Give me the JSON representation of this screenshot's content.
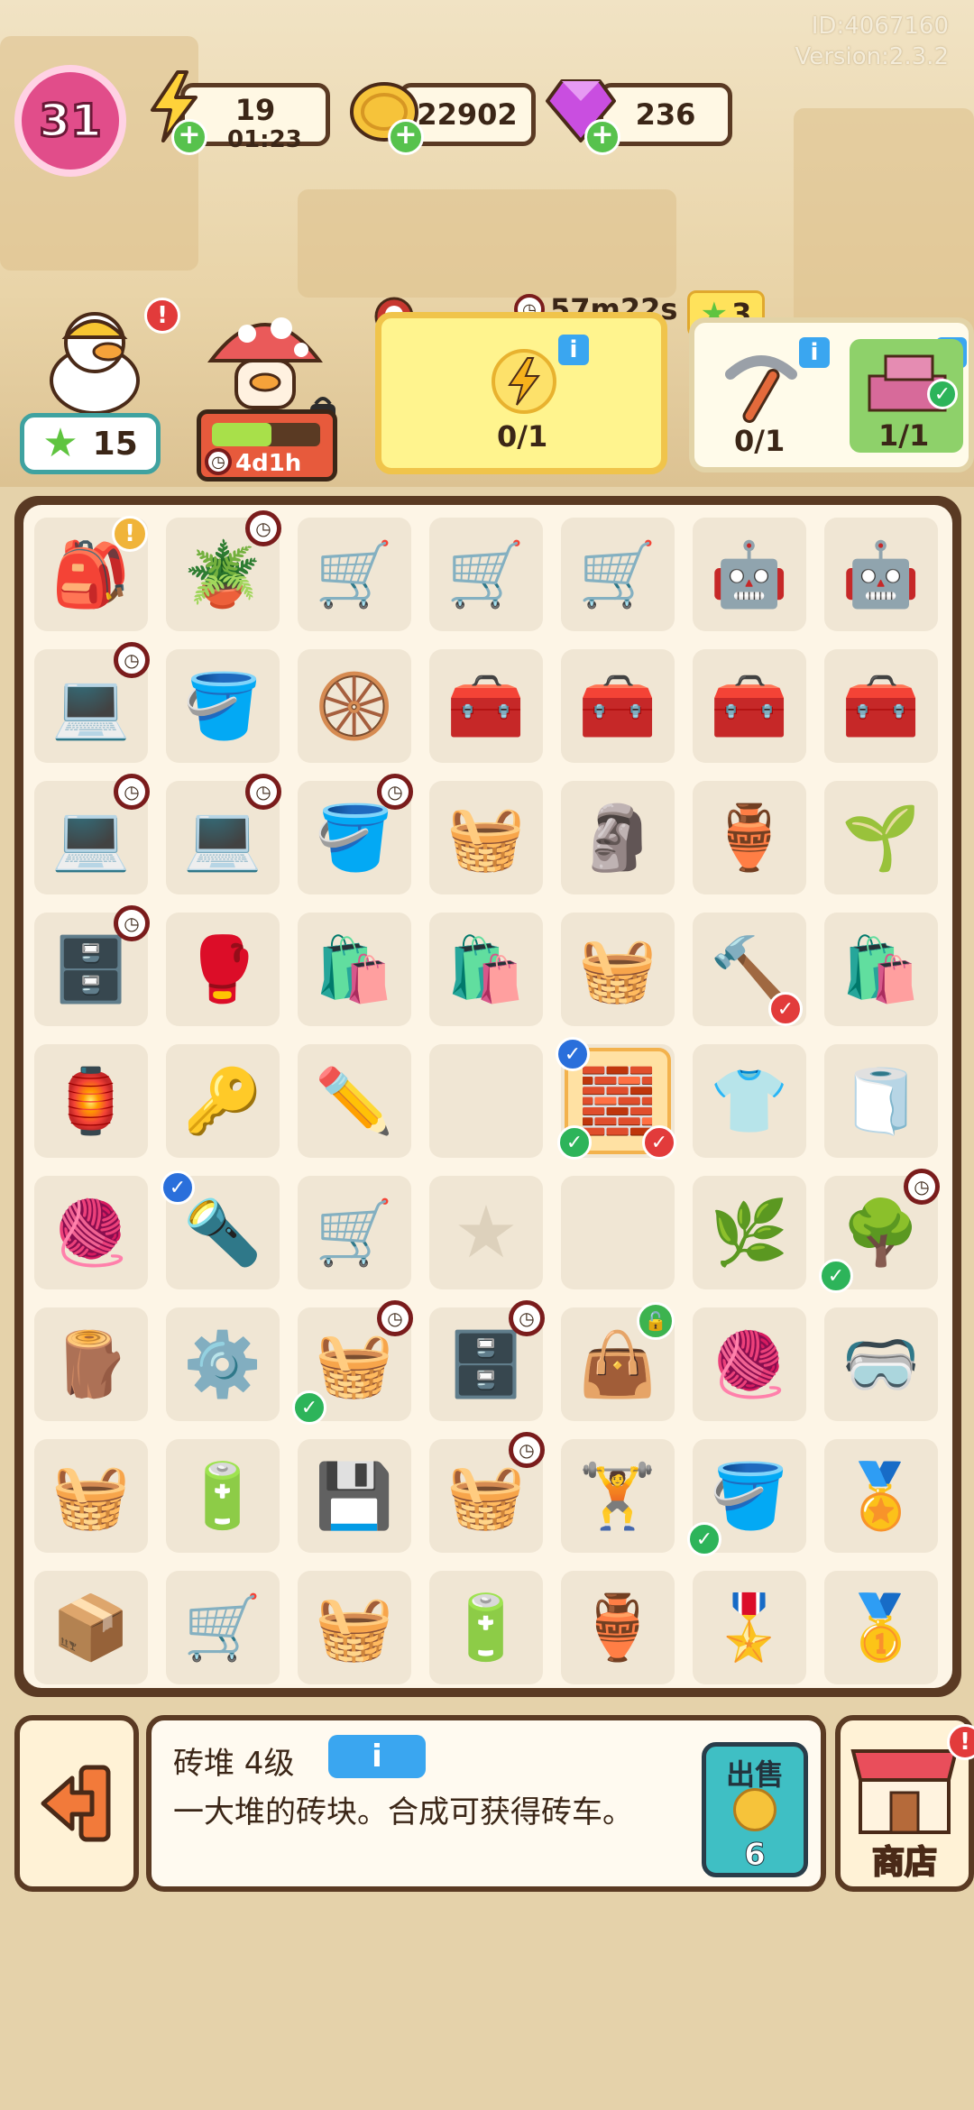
{
  "meta": {
    "id_text": "ID:4067160",
    "version_text": "Version:2.3.2"
  },
  "hud": {
    "level": "31",
    "energy": {
      "value": "19",
      "timer": "01:23",
      "icon": "lightning-icon"
    },
    "coins": {
      "value": "22902",
      "icon": "coin-icon"
    },
    "gems": {
      "value": "236",
      "icon": "gem-icon"
    }
  },
  "characters": {
    "duck_stars": "15",
    "mushroom_timer": "4d1h",
    "mushroom_progress": 0.55
  },
  "orders": {
    "timer": "57m22s",
    "reward_stars": "3",
    "order_a": {
      "count": "0/1"
    },
    "order_b": {
      "items": [
        {
          "count": "0/1",
          "icon": "pickaxe-icon"
        },
        {
          "count": "1/1",
          "icon": "bricks-icon"
        }
      ]
    }
  },
  "board": {
    "rows": [
      [
        {
          "icon": "🎒",
          "name": "backpack",
          "badge": "alert"
        },
        {
          "icon": "🪴",
          "name": "seed-pot",
          "badge": "clock"
        },
        {
          "icon": "🛒",
          "name": "tool-cart"
        },
        {
          "icon": "🛒",
          "name": "tool-cart"
        },
        {
          "icon": "🛒",
          "name": "duck-cart"
        },
        {
          "icon": "🤖",
          "name": "robot-vacuum"
        },
        {
          "icon": "🤖",
          "name": "robot-vacuum"
        }
      ],
      [
        {
          "icon": "💻",
          "name": "laptop",
          "badge": "clock"
        },
        {
          "icon": "🪣",
          "name": "plaster-bucket"
        },
        {
          "icon": "🛞",
          "name": "wheelbarrow"
        },
        {
          "icon": "🧰",
          "name": "toolbox"
        },
        {
          "icon": "🧰",
          "name": "toolbox"
        },
        {
          "icon": "🧰",
          "name": "toolbox"
        },
        {
          "icon": "🧰",
          "name": "toolbox"
        }
      ],
      [
        {
          "icon": "💻",
          "name": "laptop",
          "badge": "clock"
        },
        {
          "icon": "💻",
          "name": "laptop",
          "badge": "clock"
        },
        {
          "icon": "🪣",
          "name": "tool-bucket",
          "badge": "clock"
        },
        {
          "icon": "🧺",
          "name": "flower-basket"
        },
        {
          "icon": "🗿",
          "name": "statue"
        },
        {
          "icon": "🏺",
          "name": "broken-pot"
        },
        {
          "icon": "🌱",
          "name": "terrarium"
        }
      ],
      [
        {
          "icon": "🗄️",
          "name": "drawer",
          "badge": "clock"
        },
        {
          "icon": "🥊",
          "name": "boxing-glove"
        },
        {
          "icon": "🛍️",
          "name": "soil-bag"
        },
        {
          "icon": "🛍️",
          "name": "soil-bag"
        },
        {
          "icon": "🧺",
          "name": "junk-bin"
        },
        {
          "icon": "🔨",
          "name": "hammer",
          "badge": "red"
        },
        {
          "icon": "🛍️",
          "name": "soil-bag"
        }
      ],
      [
        {
          "icon": "🏮",
          "name": "lamp-base"
        },
        {
          "icon": "🔑",
          "name": "keys"
        },
        {
          "icon": "✏️",
          "name": "pencil"
        },
        {
          "icon": "",
          "name": "empty"
        },
        {
          "icon": "🧱",
          "name": "brick-pile",
          "badge": "selected"
        },
        {
          "icon": "👕",
          "name": "shirt"
        },
        {
          "icon": "🧻",
          "name": "paint-roller"
        }
      ],
      [
        {
          "icon": "🧶",
          "name": "cord-reel"
        },
        {
          "icon": "🔦",
          "name": "drill",
          "badge": "blue"
        },
        {
          "icon": "🛒",
          "name": "hand-cart"
        },
        {
          "icon": "star",
          "name": "empty"
        },
        {
          "icon": "",
          "name": "empty"
        },
        {
          "icon": "🌿",
          "name": "plant-pot"
        },
        {
          "icon": "🌳",
          "name": "small-tree",
          "badge": "clock-check"
        }
      ],
      [
        {
          "icon": "🪵",
          "name": "clay-pot"
        },
        {
          "icon": "⚙️",
          "name": "wheels"
        },
        {
          "icon": "🧺",
          "name": "junk-bin",
          "badge": "clock-check"
        },
        {
          "icon": "🗄️",
          "name": "drawer",
          "badge": "clock"
        },
        {
          "icon": "👜",
          "name": "black-bag",
          "badge": "lock"
        },
        {
          "icon": "🧶",
          "name": "cord-reel"
        },
        {
          "icon": "🥽",
          "name": "vr-goggles"
        }
      ],
      [
        {
          "icon": "🧺",
          "name": "basket-crate"
        },
        {
          "icon": "🔋",
          "name": "chips"
        },
        {
          "icon": "💾",
          "name": "circuit-board"
        },
        {
          "icon": "🧺",
          "name": "junk-bin",
          "badge": "clock"
        },
        {
          "icon": "🏋️",
          "name": "weight-bench"
        },
        {
          "icon": "🪣",
          "name": "paint-bucket",
          "badge": "check"
        },
        {
          "icon": "🏅",
          "name": "medal"
        }
      ],
      [
        {
          "icon": "📦",
          "name": "box"
        },
        {
          "icon": "🛒",
          "name": "shopping-cart"
        },
        {
          "icon": "🧺",
          "name": "woven-basket"
        },
        {
          "icon": "🔋",
          "name": "capacitor"
        },
        {
          "icon": "🏺",
          "name": "broken-pot"
        },
        {
          "icon": "🎖️",
          "name": "badge-medal"
        },
        {
          "icon": "🥇",
          "name": "gold-medal"
        }
      ]
    ]
  },
  "bottom": {
    "item_title": "砖堆 4级",
    "info_label": "i",
    "item_desc": "一大堆的砖块。合成可获得砖车。",
    "sell_label": "出售",
    "sell_price": "6",
    "shop_label": "商店"
  }
}
